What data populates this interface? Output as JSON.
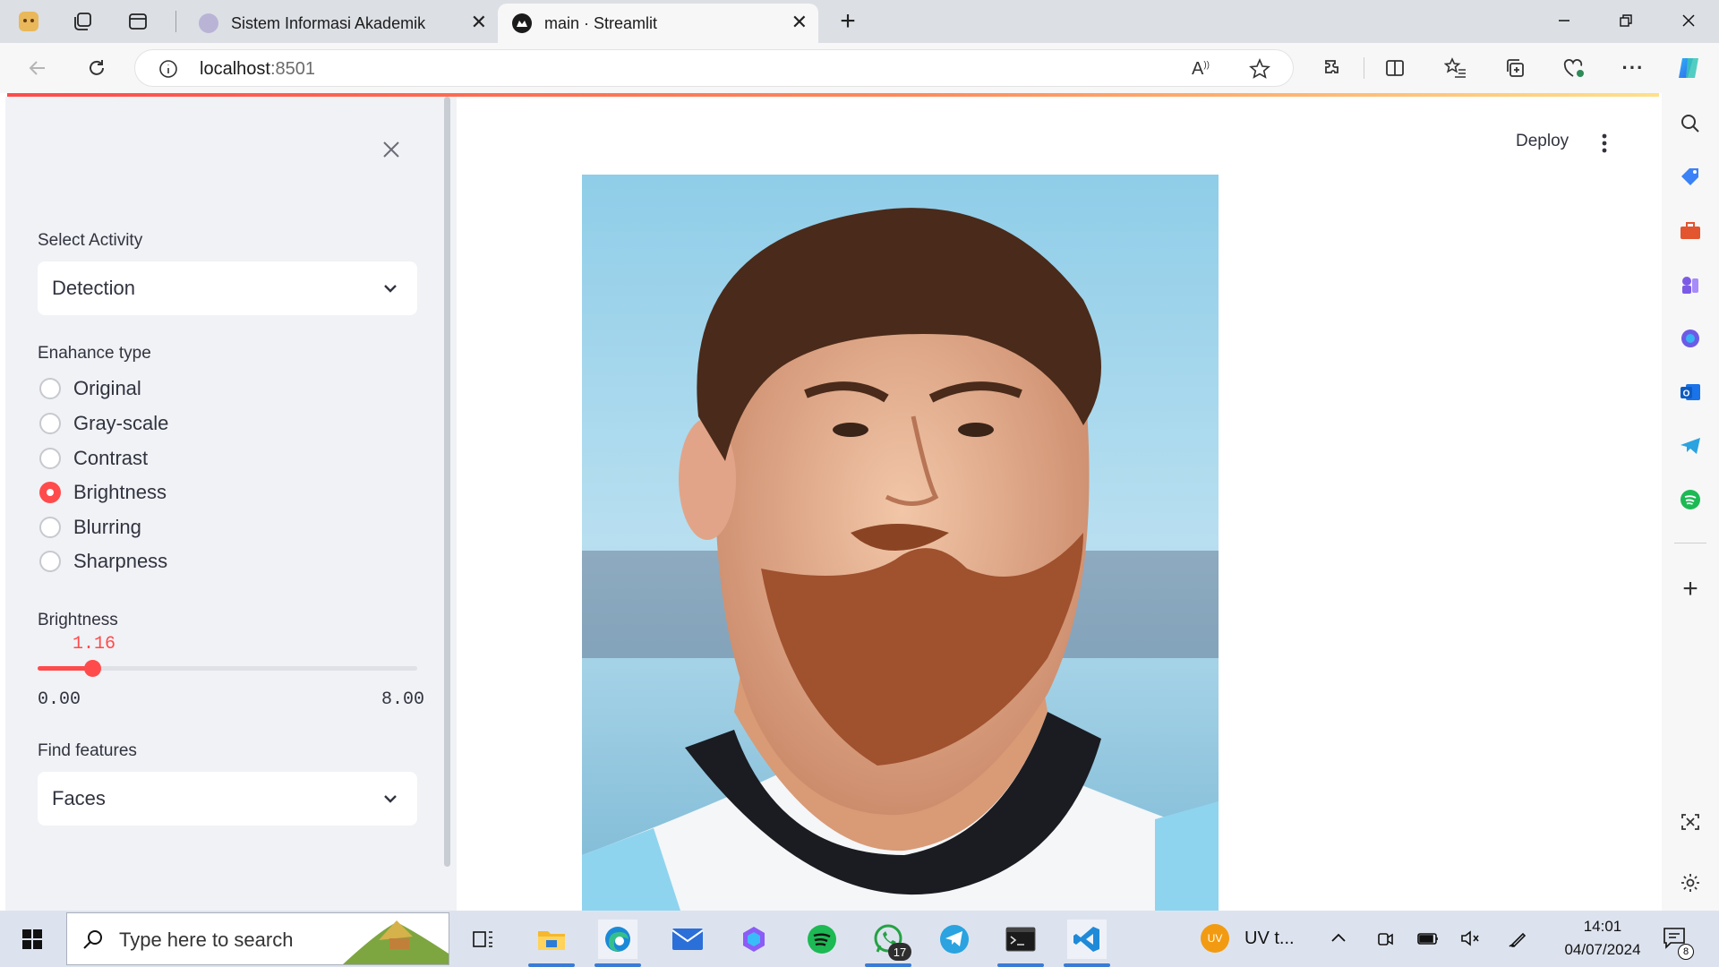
{
  "browser": {
    "tabs": [
      {
        "title": "Sistem Informasi Akademik",
        "active": false
      },
      {
        "title": "main · Streamlit",
        "active": true
      }
    ],
    "address": {
      "host": "localhost",
      "port": ":8501"
    },
    "new_tab_icon": "plus-icon"
  },
  "app": {
    "deploy_label": "Deploy",
    "sidebar": {
      "activity_label": "Select Activity",
      "activity_value": "Detection",
      "enhance_label": "Enahance type",
      "enhance_options": [
        "Original",
        "Gray-scale",
        "Contrast",
        "Brightness",
        "Blurring",
        "Sharpness"
      ],
      "enhance_selected": "Brightness",
      "brightness_label": "Brightness",
      "brightness_value": "1.16",
      "brightness_min": "0.00",
      "brightness_max": "8.00",
      "brightness_fraction": 0.145,
      "features_label": "Find features",
      "features_value": "Faces"
    },
    "accent_color": "#ff4b4b"
  },
  "taskbar": {
    "search_placeholder": "Type here to search",
    "whatsapp_badge": "17",
    "tray_app_label": "UV t...",
    "tray_app_avatar": "UV",
    "time": "14:01",
    "date": "04/07/2024",
    "notification_count": "8"
  }
}
